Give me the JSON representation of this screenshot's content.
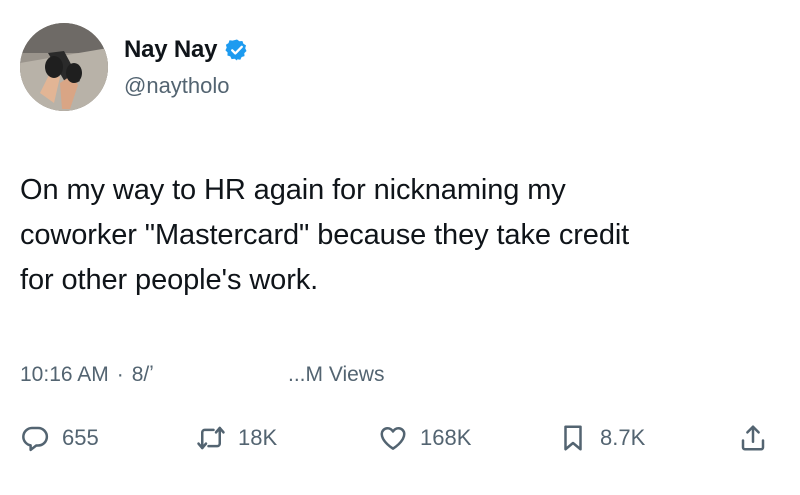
{
  "author": {
    "display_name": "Nay Nay",
    "handle": "@naytholo",
    "verified_icon": "verified-badge-icon",
    "verified_color": "#1d9bf0"
  },
  "tweet": {
    "text_lines": [
      "On my way to HR again for nicknaming my",
      "coworker \"Mastercard\" because they take credit",
      "for other people's work."
    ]
  },
  "meta": {
    "time": "10:16 AM",
    "separator": "·",
    "date_fragment": "8/ʼ",
    "views_text": "...M Views"
  },
  "actions": {
    "reply_count": "655",
    "retweet_count": "18K",
    "like_count": "168K",
    "bookmark_count": "8.7K"
  },
  "colors": {
    "text": "#0f1419",
    "secondary": "#536471"
  }
}
